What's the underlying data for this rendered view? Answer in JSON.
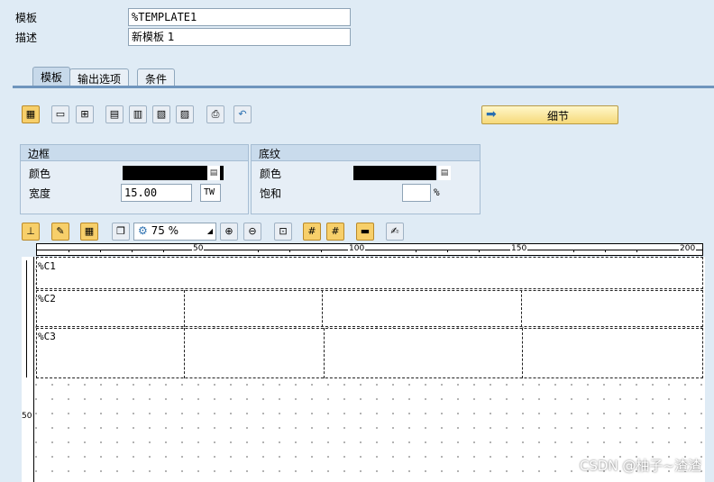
{
  "header": {
    "template_label": "模板",
    "template_value": "%TEMPLATE1",
    "desc_label": "描述",
    "desc_value": "新模板 1"
  },
  "tabs": [
    {
      "label": "模板"
    },
    {
      "label": "输出选项"
    },
    {
      "label": "条件"
    }
  ],
  "toolbar": {
    "detail_label": "细节"
  },
  "border_group": {
    "title": "边框",
    "color_label": "颜色",
    "width_label": "宽度",
    "width_value": "15.00",
    "width_unit": "TW"
  },
  "shading_group": {
    "title": "底纹",
    "color_label": "颜色",
    "saturation_label": "饱和",
    "saturation_unit": "%"
  },
  "canvas_toolbar": {
    "zoom_value": "75 %"
  },
  "ruler": {
    "marks": [
      "50",
      "100",
      "150",
      "200"
    ],
    "vertical_mark": "50"
  },
  "rows": [
    {
      "label": "%C1"
    },
    {
      "label": "%C2"
    },
    {
      "label": "%C3"
    }
  ],
  "watermark": "CSDN @柚子~渣渣",
  "colors": {
    "panel_bg": "#dfebf5",
    "tab_active": "#c7d9ea",
    "detail_button": "#f6d97a"
  }
}
